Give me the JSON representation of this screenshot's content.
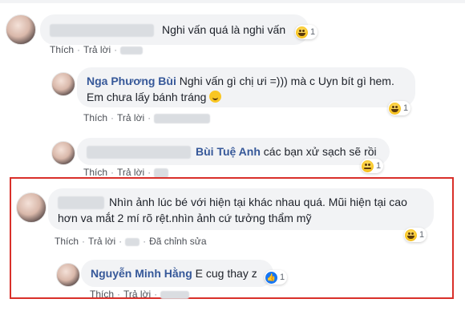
{
  "colors": {
    "highlight_border": "#d9302a",
    "name_link": "#365899",
    "bubble_bg": "#f2f3f5"
  },
  "comments": [
    {
      "name": "",
      "text": "Nghi vấn quá là nghi vấn",
      "reaction_icon": "haha-icon",
      "reaction_count": "1",
      "actions": {
        "like": "Thích",
        "reply": "Trả lời"
      }
    },
    {
      "name": "Nga Phương Bùi",
      "text": "Nghi vấn gì chị ưi =))) mà c Uyn bít gì hem. Em chưa lấy bánh tráng",
      "reaction_icon": "haha-icon",
      "reaction_count": "1",
      "actions": {
        "like": "Thích",
        "reply": "Trả lời"
      }
    },
    {
      "name": "Bùi Tuệ Anh",
      "text": "các bạn xử sạch sẽ rồi",
      "reaction_icon": "sad-icon",
      "reaction_count": "1",
      "actions": {
        "like": "Thích",
        "reply": "Trả lời"
      }
    },
    {
      "name": "",
      "text_line1": "Nhìn ảnh lúc bé với hiện tại khác nhau quá. Mũi hiện tại cao",
      "text_line2": "hơn va mắt 2 mí rõ rệt.nhìn ảnh cứ tưởng thẩm mỹ",
      "reaction_icon": "haha-icon",
      "reaction_count": "1",
      "actions": {
        "like": "Thích",
        "reply": "Trả lời",
        "edited": "Đã chỉnh sửa"
      }
    },
    {
      "name": "Nguyễn Minh Hằng",
      "text": "E cug thay z",
      "reaction_icon": "like-icon",
      "reaction_count": "1",
      "actions": {
        "like": "Thích",
        "reply": "Trả lời"
      }
    }
  ]
}
